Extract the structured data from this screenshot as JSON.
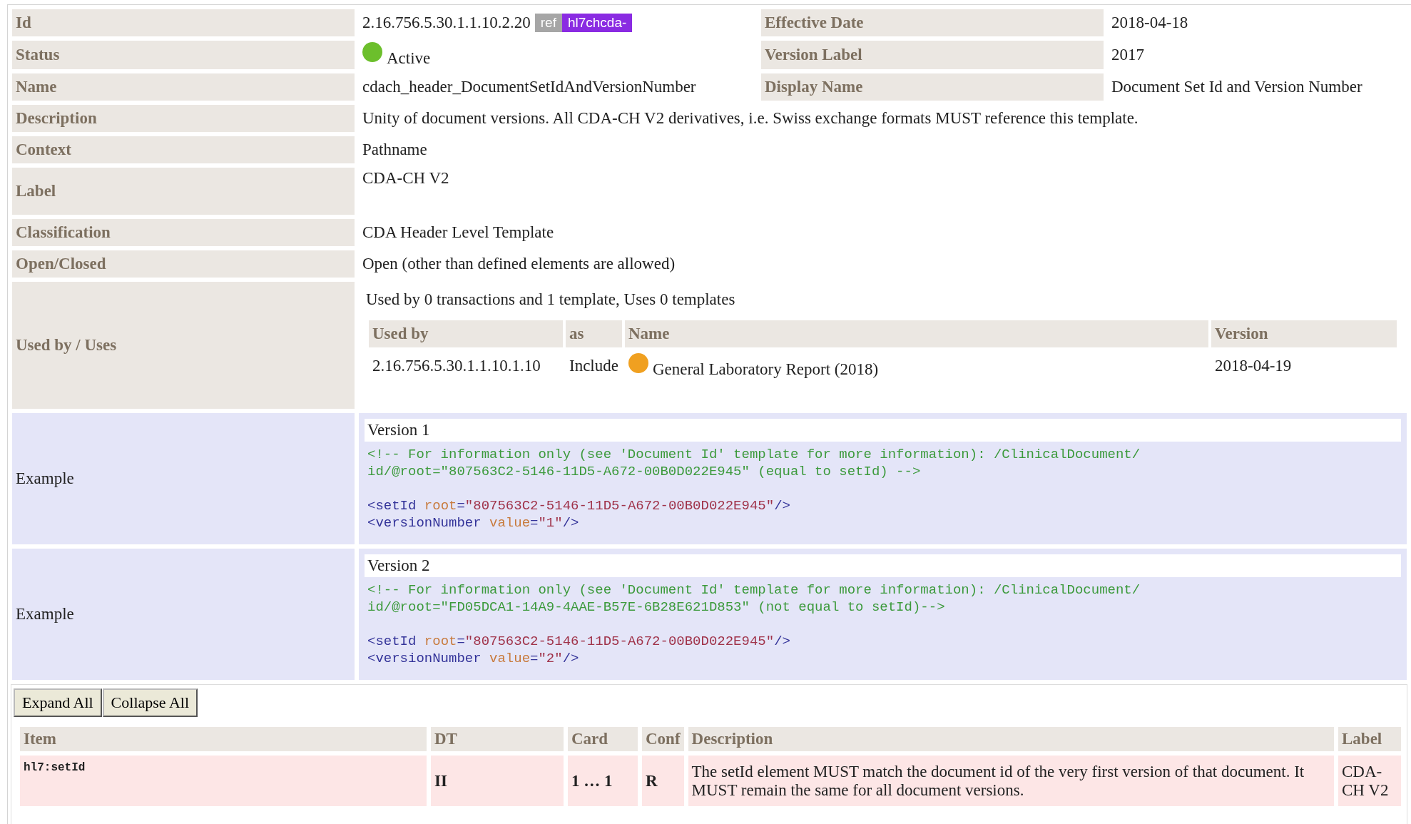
{
  "properties": [
    {
      "kind": "pair",
      "label": "Id",
      "value": "2.16.756.5.30.1.1.10.2.20",
      "badges": [
        {
          "kind": "ref",
          "text": "ref"
        },
        {
          "kind": "prefix",
          "text": "hl7chcda-"
        }
      ],
      "label2": "Effective Date",
      "value2": "2018-04-18"
    },
    {
      "kind": "status",
      "label": "Status",
      "color": "#6cbf2c",
      "value": "Active",
      "label2": "Version Label",
      "value2": "2017"
    },
    {
      "kind": "pair",
      "label": "Name",
      "value": "cdach_header_DocumentSetIdAndVersionNumber",
      "label2": "Display Name",
      "value2": "Document Set Id and Version Number"
    },
    {
      "kind": "wide",
      "label": "Description",
      "value": "Unity of document versions. All CDA-CH V2 derivatives, i.e. Swiss exchange formats MUST reference this template."
    },
    {
      "kind": "wide",
      "label": "Context",
      "value": "Pathname"
    },
    {
      "kind": "tall",
      "label": "Label",
      "value": "CDA-CH V2"
    },
    {
      "kind": "wide",
      "label": "Classification",
      "value": "CDA Header Level Template"
    },
    {
      "kind": "wide",
      "label": "Open/Closed",
      "value": "Open (other than defined elements are allowed)"
    }
  ],
  "usage": {
    "label": "Used by / Uses",
    "summary": "Used by 0 transactions and 1 template, Uses 0 templates",
    "columns": [
      "Used by",
      "as",
      "Name",
      "Version"
    ],
    "rows": [
      {
        "used_by": "2.16.756.5.30.1.1.10.1.10",
        "as": "Include",
        "color": "#f0a020",
        "name": "General Laboratory Report (2018)",
        "version": "2018-04-19"
      }
    ]
  },
  "examples": [
    {
      "label": "Example",
      "caption": "Version 1",
      "comment_lines": [
        "<!-- For information only (see 'Document Id' template for more information): /ClinicalDocument/",
        "id/@root=\"807563C2-5146-11D5-A672-00B0D022E945\" (equal to setId) -->"
      ],
      "code_lines": [
        [
          {
            "kind": "tag",
            "text": "<setId"
          },
          {
            "kind": "attr",
            "text": " root"
          },
          {
            "kind": "tag",
            "text": "="
          },
          {
            "kind": "string",
            "text": "\"807563C2-5146-11D5-A672-00B0D022E945\""
          },
          {
            "kind": "tag",
            "text": "/>"
          }
        ],
        [
          {
            "kind": "tag",
            "text": "<versionNumber"
          },
          {
            "kind": "attr",
            "text": " value"
          },
          {
            "kind": "tag",
            "text": "="
          },
          {
            "kind": "string",
            "text": "\"1\""
          },
          {
            "kind": "tag",
            "text": "/>"
          }
        ]
      ]
    },
    {
      "label": "Example",
      "caption": "Version 2",
      "comment_lines": [
        "<!-- For information only (see 'Document Id' template for more information): /ClinicalDocument/",
        "id/@root=\"FD05DCA1-14A9-4AAE-B57E-6B28E621D853\" (not equal to setId)-->"
      ],
      "code_lines": [
        [
          {
            "kind": "tag",
            "text": "<setId"
          },
          {
            "kind": "attr",
            "text": " root"
          },
          {
            "kind": "tag",
            "text": "="
          },
          {
            "kind": "string",
            "text": "\"807563C2-5146-11D5-A672-00B0D022E945\""
          },
          {
            "kind": "tag",
            "text": "/>"
          }
        ],
        [
          {
            "kind": "tag",
            "text": "<versionNumber"
          },
          {
            "kind": "attr",
            "text": " value"
          },
          {
            "kind": "tag",
            "text": "="
          },
          {
            "kind": "string",
            "text": "\"2\""
          },
          {
            "kind": "tag",
            "text": "/>"
          }
        ]
      ]
    }
  ],
  "buttons": [
    "Expand All",
    "Collapse All"
  ],
  "elements": {
    "columns": [
      "Item",
      "DT",
      "Card",
      "Conf",
      "Description",
      "Label"
    ],
    "rows": [
      {
        "item": "hl7:setId",
        "dt": "II",
        "card": "1 … 1",
        "conf": "R",
        "description": "The setId element MUST match the document id of the very first version of that document. It MUST remain the same for all document versions.",
        "label": "CDA-CH V2"
      }
    ]
  }
}
